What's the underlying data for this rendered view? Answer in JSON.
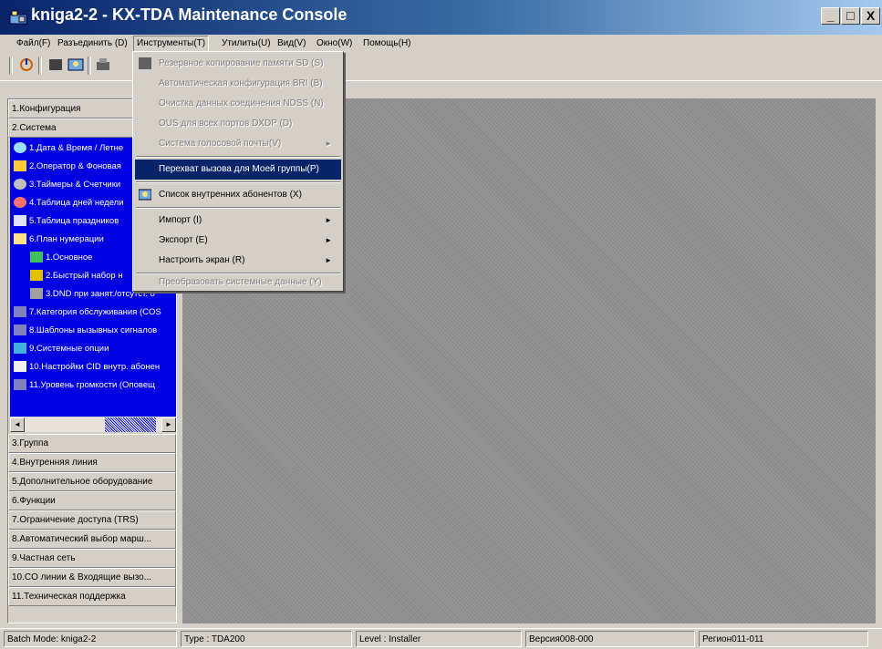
{
  "window": {
    "title": "kniga2-2 - KX-TDA Maintenance Console",
    "minimize": "_",
    "maximize": "□",
    "close": "X"
  },
  "menubar": [
    "Файл(F)",
    "Разъединить (D)",
    "Инструменты(T)",
    "Утилиты(U)",
    "Вид(V)",
    "Окно(W)",
    "Помощь(H)"
  ],
  "tools_menu": {
    "items": [
      {
        "label": "Резервное копирование памяти SD (S)",
        "disabled": true
      },
      {
        "label": "Автоматическая конфигурация BRI (B)",
        "disabled": true
      },
      {
        "label": "Очистка данных соединения NDSS (N)",
        "disabled": true
      },
      {
        "label": "OUS для всех портов DXDP (D)",
        "disabled": true
      },
      {
        "label": "Система голосовой почты(V)",
        "disabled": true
      },
      {
        "label": "Перехват вызова для Моей группы(P)",
        "highlighted": true
      },
      {
        "label": "Список внутренних абонентов (X)"
      },
      {
        "label": "Импорт (I)"
      },
      {
        "label": "Экспорт (E)"
      },
      {
        "label": "Настроить экран (R)"
      },
      {
        "label": "Преобразовать системные данные (Y)",
        "disabled": true
      }
    ],
    "submenu_arrow": "►"
  },
  "nav": {
    "top_sections": [
      "1.Конфигурация",
      "2.Система"
    ],
    "tree_items": [
      "1.Дата & Время / Летне",
      "2.Оператор & Фоновая",
      "3.Таймеры & Счетчики",
      "4.Таблица дней недели",
      "5.Таблица праздников",
      "6.План нумерации",
      "1.Основное",
      "2.Быстрый набор н",
      "3.DND при занят./отсутст. о",
      "7.Категория обслуживания (COS",
      "8.Шаблоны вызывных сигналов",
      "9.Системные опции",
      "10.Настройки CID внутр. абонен",
      "11.Уровень громкости (Оповещ"
    ],
    "bottom_sections": [
      "3.Группа",
      "4.Внутренняя линия",
      "5.Дополнительное оборудование",
      "6.Функции",
      "7.Ограничение доступа (TRS)",
      "8.Автоматический выбор марш...",
      "9.Частная сеть",
      "10.CO линии & Входящие вызо...",
      "11.Техническая поддержка"
    ],
    "scroll_left": "◄",
    "scroll_right": "►"
  },
  "statusbar": [
    "Batch Mode: kniga2-2",
    "Type : TDA200",
    "Level : Installer",
    "Версия008-000",
    "Регион011-011"
  ],
  "colors": {
    "titlebar_start": "#0a246a",
    "tree_background": "#0000e0",
    "menu_highlight": "#0a246a",
    "client_background": "#8c8c8c"
  }
}
